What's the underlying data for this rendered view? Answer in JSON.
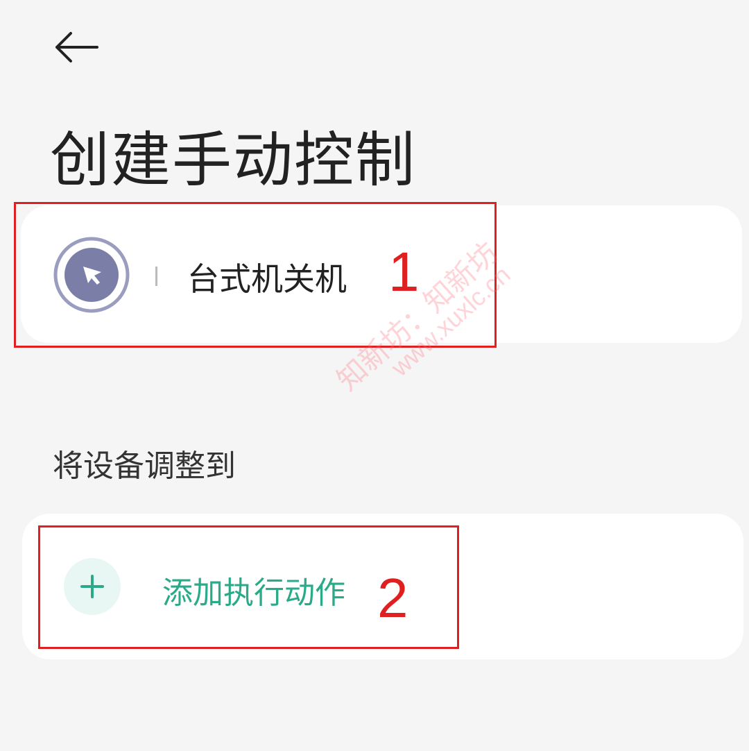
{
  "header": {
    "back_icon": "arrow-left-icon",
    "title": "创建手动控制"
  },
  "name_card": {
    "icon": "cursor-pointer-icon",
    "name": "台式机关机"
  },
  "section": {
    "label": "将设备调整到"
  },
  "action_card": {
    "icon": "plus-icon",
    "label": "添加执行动作"
  },
  "annotations": {
    "marker_1": "1",
    "marker_2": "2",
    "color": "#e02020"
  },
  "watermark": {
    "line1": "知新坊：知新坊",
    "line2": "www.xuxlc.cn"
  },
  "colors": {
    "background": "#f5f5f5",
    "card": "#ffffff",
    "accent": "#2aaa88",
    "icon_ring": "#9a9dbf",
    "icon_fill": "#7b7fa8"
  }
}
